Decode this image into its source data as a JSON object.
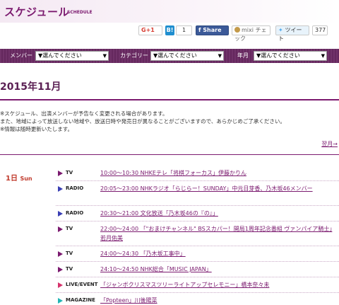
{
  "header": {
    "title": "スケジュール",
    "subtitle": "SCHEDULE"
  },
  "social": {
    "gplus_label": "G+1",
    "hatena_icon": "B!",
    "hatena_count": "1",
    "fb_label": "Share",
    "mixi_label": "mixi チェック",
    "tweet_label": "ツイート",
    "tweet_count": "377"
  },
  "filters": {
    "member_label": "メンバー",
    "member_value": "▼選んでください",
    "category_label": "カテゴリー",
    "category_value": "▼選んでください",
    "year_label": "年月",
    "year_value": "▼選んでください"
  },
  "month_heading": "2015年11月",
  "notes": [
    "※スケジュール、出演メンバーが予告なく変更される場合があります。",
    "また、地域によって放送しない地域や、放送日時や発売日が異なることがございますので、あらかじめご了承ください。",
    "※情報は随時更新いたします。"
  ],
  "next_month": "翌月→",
  "day": {
    "date": "1日",
    "dow": "Sun"
  },
  "entries": [
    {
      "category": "TV",
      "text": "10:00〜10:30 NHKEテレ「将棋フォーカス」伊藤かりん",
      "color": "#7b1a6f"
    },
    {
      "category": "RADIO",
      "text": "20:05〜23:00 NHKラジオ「らじらー！SUNDAY」中元日芽香、乃木坂46メンバー",
      "color": "#3a3fb4"
    },
    {
      "category": "RADIO",
      "text": "20:30〜21:00 文化放送「乃木坂46の『の』」",
      "color": "#3a3fb4"
    },
    {
      "category": "TV",
      "text": "22:00〜24:00 「\"おまけチャンネル\" BSスカパー！開局1周年記念番組 ヴァンパイア騎士」若月佑美",
      "color": "#7b1a6f"
    },
    {
      "category": "TV",
      "text": "24:00〜24:30 「乃木坂工事中」",
      "color": "#7b1a6f"
    },
    {
      "category": "TV",
      "text": "24:10〜24:50 NHK総合「MUSIC JAPAN」",
      "color": "#7b1a6f"
    },
    {
      "category": "LIVE/EVENT",
      "text": "「ジャンボクリスマスツリーライトアップセレモニー」橋本奈々未",
      "color": "#d6336c"
    },
    {
      "category": "MAGAZINE",
      "text": "「Popteen」川後陽菜",
      "color": "#23b5b5"
    }
  ]
}
